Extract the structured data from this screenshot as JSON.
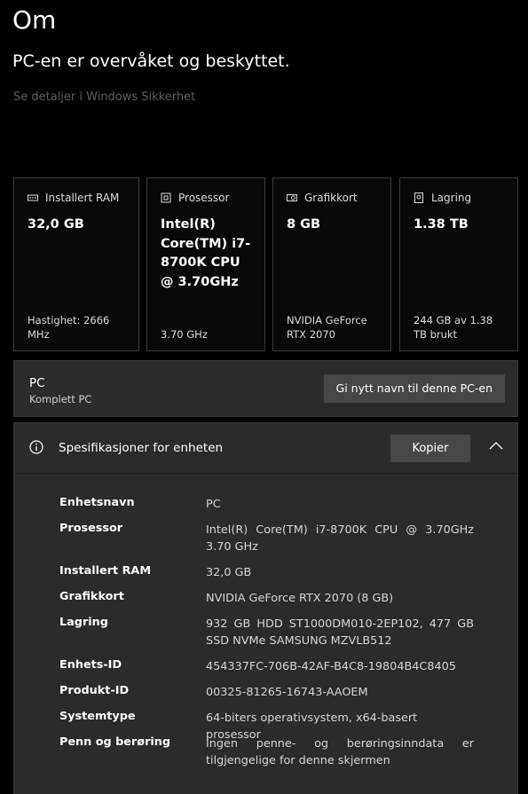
{
  "header": {
    "title": "Om",
    "status": "PC-en er overvåket og beskyttet.",
    "details_link": "Se detaljer i Windows Sikkerhet"
  },
  "cards": [
    {
      "label": "Installert RAM",
      "icon": "memory-icon",
      "value": "32,0 GB",
      "footer": "Hastighet: 2666 MHz"
    },
    {
      "label": "Prosessor",
      "icon": "processor-icon",
      "value": "Intel(R) Core(TM) i7-8700K CPU @ 3.70GHz",
      "footer": "3.70 GHz"
    },
    {
      "label": "Grafikkort",
      "icon": "graphics-card-icon",
      "value": "8 GB",
      "footer": "NVIDIA GeForce RTX 2070"
    },
    {
      "label": "Lagring",
      "icon": "storage-icon",
      "value": "1.38 TB",
      "footer": "244 GB av 1.38 TB brukt"
    }
  ],
  "pc": {
    "name": "PC",
    "subtitle": "Komplett PC",
    "rename_label": "Gi nytt navn til denne PC-en"
  },
  "specs": {
    "title": "Spesifikasjoner for enheten",
    "copy_label": "Kopier",
    "rows": [
      {
        "label": "Enhetsnavn",
        "value": "PC"
      },
      {
        "label": "Prosessor",
        "value": "Intel(R) Core(TM) i7-8700K CPU @ 3.70GHz 3.70 GHz"
      },
      {
        "label": "Installert RAM",
        "value": "32,0 GB"
      },
      {
        "label": "Grafikkort",
        "value": "NVIDIA GeForce RTX 2070 (8 GB)"
      },
      {
        "label": "Lagring",
        "value": "932 GB HDD ST1000DM010-2EP102, 477 GB SSD NVMe SAMSUNG MZVLB512"
      },
      {
        "label": "Enhets-ID",
        "value": "454337FC-706B-42AF-B4C8-19804B4C8405"
      },
      {
        "label": "Produkt-ID",
        "value": "00325-81265-16743-AAOEM"
      },
      {
        "label": "Systemtype",
        "value": "64-biters operativsystem, x64-basert prosessor"
      },
      {
        "label": "Penn og berøring",
        "value": "Ingen penne- og berøringsinndata er tilgjengelige for denne skjermen"
      }
    ]
  }
}
